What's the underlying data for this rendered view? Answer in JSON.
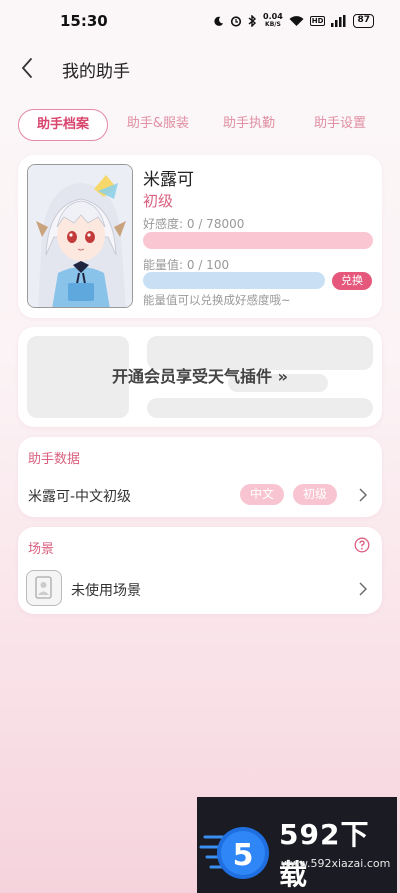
{
  "status_bar": {
    "time": "15:30",
    "net_speed_value": "0.04",
    "net_speed_unit": "KB/S",
    "hd": "HD",
    "battery": "87"
  },
  "header": {
    "title": "我的助手",
    "back_icon": "chevron-left-icon"
  },
  "tabs": [
    {
      "label": "助手档案",
      "active": true
    },
    {
      "label": "助手&服装",
      "active": false
    },
    {
      "label": "助手执勤",
      "active": false
    },
    {
      "label": "助手设置",
      "active": false
    }
  ],
  "profile": {
    "name": "米露可",
    "level": "初级",
    "favor_label": "好感度:",
    "favor_value": "0 / 78000",
    "favor_progress": 0,
    "energy_label": "能量值:",
    "energy_value": "0 / 100",
    "energy_progress": 0,
    "exchange_button": "兑换",
    "energy_hint": "能量值可以兑换成好感度哦~"
  },
  "weather_promo": {
    "text": "开通会员享受天气插件 »"
  },
  "assistant_data": {
    "title": "助手数据",
    "row_text": "米露可-中文初级",
    "tags": [
      "中文",
      "初级"
    ]
  },
  "scene": {
    "title": "场景",
    "row_text": "未使用场景",
    "help_icon": "question-circle-icon"
  },
  "watermark": {
    "brand": "592下载",
    "url": "www.592xiazai.com",
    "logo_char": "5"
  },
  "colors": {
    "accent": "#d9466d",
    "favor_bar": "#f9c6d2",
    "energy_bar": "#c9e0f4",
    "exchange": "#e5587c",
    "tag": "#f8c4d1"
  }
}
